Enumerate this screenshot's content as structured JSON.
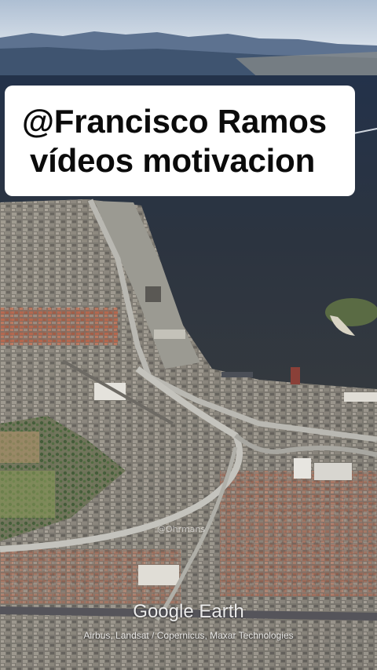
{
  "caption": {
    "line1": "@Francisco Ramos",
    "line2": "vídeos motivacion"
  },
  "overlay": {
    "handle_watermark": "@Ohrmans",
    "brand": "Google Earth",
    "credits": "Airbus, Landsat / Copernicus, Maxar Technologies"
  },
  "colors": {
    "sky": "#c9d6e6",
    "bay_water": "#2b3442",
    "caption_background": "#ffffff",
    "caption_text": "#0b0b0b"
  }
}
